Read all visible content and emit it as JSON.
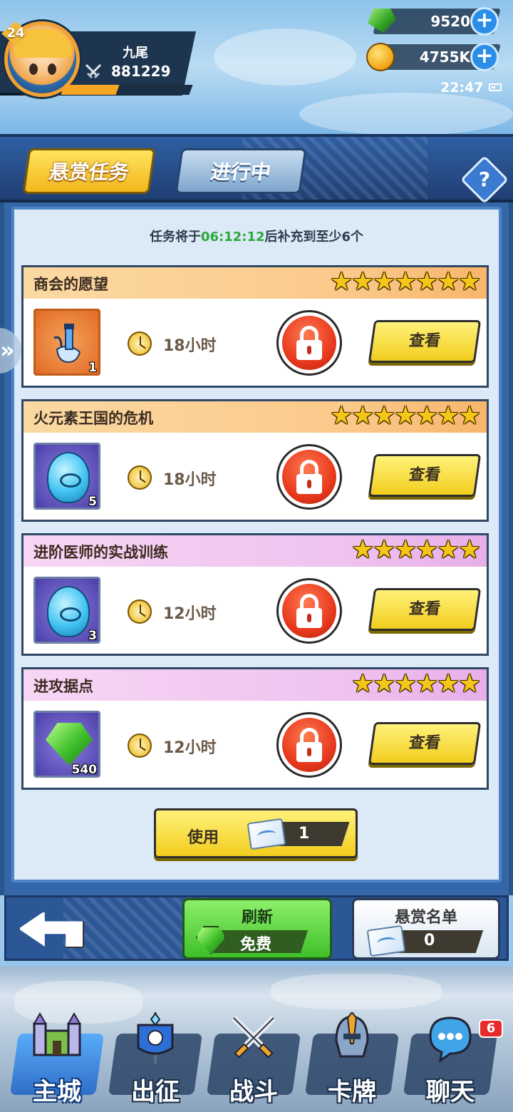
{
  "player": {
    "level": "24",
    "name": "九尾",
    "power": "881229",
    "xp_fraction": 0.43
  },
  "currencies": {
    "gems": "9520",
    "gold": "4755K"
  },
  "status": {
    "time": "22:47"
  },
  "tabs": [
    {
      "label": "悬赏任务",
      "active": true
    },
    {
      "label": "进行中",
      "active": false
    }
  ],
  "help": {
    "label": "?"
  },
  "refill_notice": {
    "prefix": "任务将于",
    "time": "06:12:12",
    "suffix": "后补充到至少6个"
  },
  "quests": [
    {
      "title": "商会的愿望",
      "stars": 7,
      "reward_icon": "potion-icon",
      "reward_count": "1",
      "duration": "18小时",
      "action_label": "查看",
      "theme": "orange"
    },
    {
      "title": "火元素王国的危机",
      "stars": 7,
      "reward_icon": "egg-icon",
      "reward_count": "5",
      "duration": "18小时",
      "action_label": "查看",
      "theme": "orange"
    },
    {
      "title": "进阶医师的实战训练",
      "stars": 6,
      "reward_icon": "egg-icon",
      "reward_count": "3",
      "duration": "12小时",
      "action_label": "查看",
      "theme": "pink"
    },
    {
      "title": "进攻据点",
      "stars": 6,
      "reward_icon": "gem-icon",
      "reward_count": "540",
      "duration": "12小时",
      "action_label": "查看",
      "theme": "pink"
    }
  ],
  "use_bar": {
    "label": "使用",
    "count": "1"
  },
  "actions": {
    "refresh_title": "刷新",
    "refresh_cost": "免费",
    "list_title": "悬赏名单",
    "list_count": "0"
  },
  "nav": [
    {
      "label": "主城",
      "active": true
    },
    {
      "label": "出征",
      "active": false
    },
    {
      "label": "战斗",
      "active": false
    },
    {
      "label": "卡牌",
      "active": false
    },
    {
      "label": "聊天",
      "active": false,
      "badge": "6"
    }
  ],
  "colors": {
    "accent_yellow": "#f2cd1e",
    "refresh_green": "#3fbf2a",
    "lock_red": "#e8391d",
    "timer_green": "#2aa838",
    "panel_blue": "#3567a8"
  }
}
